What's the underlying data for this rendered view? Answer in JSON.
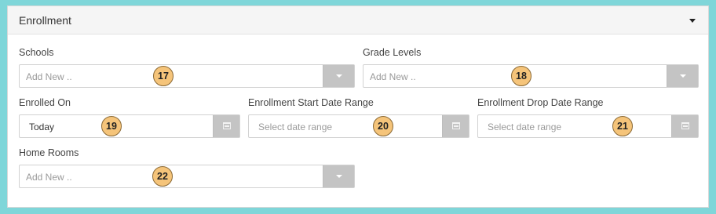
{
  "panel": {
    "title": "Enrollment"
  },
  "fields": {
    "schools": {
      "label": "Schools",
      "placeholder": "Add New ..",
      "badge": "17"
    },
    "grade_levels": {
      "label": "Grade Levels",
      "placeholder": "Add New ..",
      "badge": "18"
    },
    "enrolled_on": {
      "label": "Enrolled On",
      "value": "Today",
      "badge": "19"
    },
    "enrollment_start": {
      "label": "Enrollment Start Date Range",
      "placeholder": "Select date range",
      "badge": "20"
    },
    "enrollment_drop": {
      "label": "Enrollment Drop Date Range",
      "placeholder": "Select date range",
      "badge": "21"
    },
    "home_rooms": {
      "label": "Home Rooms",
      "placeholder": "Add New ..",
      "badge": "22"
    }
  },
  "icons": {
    "collapse": "caret-down-icon",
    "dropdown": "chevron-down-icon",
    "calendar": "calendar-icon"
  },
  "colors": {
    "frame": "#7fd6d9",
    "badge": "#f5c47a",
    "addon": "#c4c4c4"
  }
}
